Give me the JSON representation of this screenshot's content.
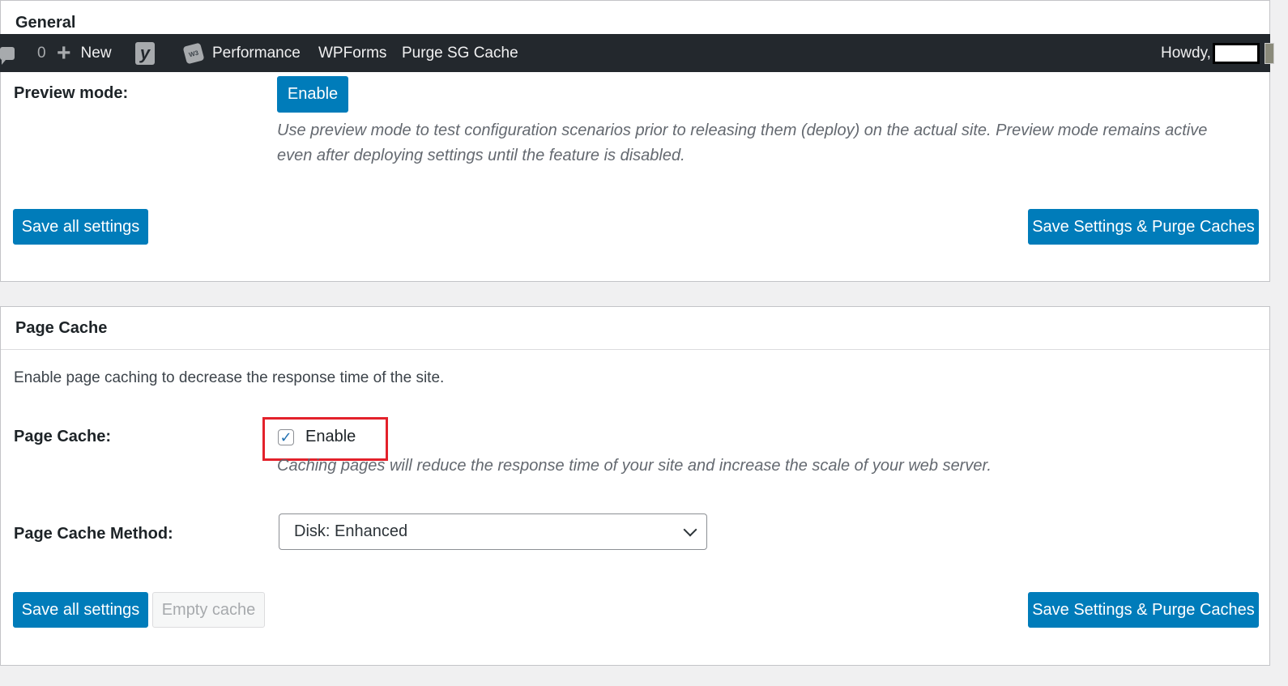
{
  "adminbar": {
    "comments_count": "0",
    "new_label": "New",
    "yoast_icon": "yoast-icon",
    "w3tc_icon": "w3-total-cache-icon",
    "performance_label": "Performance",
    "wpforms_label": "WPForms",
    "purge_label": "Purge SG Cache",
    "howdy_label": "Howdy,"
  },
  "general": {
    "title": "General",
    "preview_label": "Preview mode:",
    "preview_button": "Enable",
    "preview_desc": "Use preview mode to test configuration scenarios prior to releasing them (deploy) on the actual site. Preview mode remains active even after deploying settings until the feature is disabled.",
    "save_all": "Save all settings",
    "save_purge": "Save Settings & Purge Caches"
  },
  "page_cache": {
    "title": "Page Cache",
    "intro": "Enable page caching to decrease the response time of the site.",
    "page_cache_label": "Page Cache:",
    "enable_checkbox_label": "Enable",
    "enable_checked": true,
    "checkbox_desc": "Caching pages will reduce the response time of your site and increase the scale of your web server.",
    "method_label": "Page Cache Method:",
    "method_value": "Disk: Enhanced",
    "save_all": "Save all settings",
    "empty_cache": "Empty cache",
    "save_purge": "Save Settings & Purge Caches"
  },
  "colors": {
    "primary": "#007cba",
    "adminbar_bg": "#23282d",
    "highlight": "#e3212b"
  }
}
